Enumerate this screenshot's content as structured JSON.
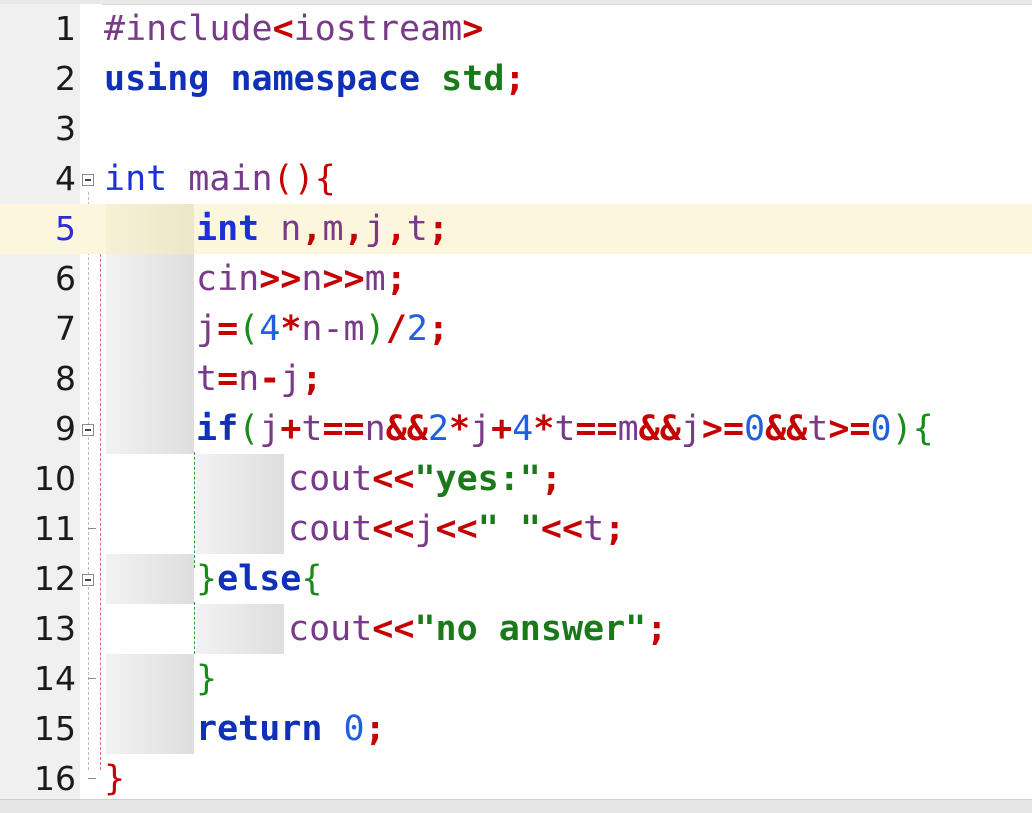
{
  "editor": {
    "language": "C++",
    "current_line": 5,
    "colors": {
      "keyword": "#1030b8",
      "operator": "#c40000",
      "number": "#2060e0",
      "string": "#1a7a1a",
      "identifier": "#7a3a8a",
      "current_line_bg": "#fbf6dc",
      "gutter_bg": "#f0f0f0"
    }
  },
  "lines": [
    {
      "num": "1",
      "text": "#include<iostream>"
    },
    {
      "num": "2",
      "text": "using namespace std;"
    },
    {
      "num": "3",
      "text": ""
    },
    {
      "num": "4",
      "text": "int main(){"
    },
    {
      "num": "5",
      "text": "int n,m,j,t;"
    },
    {
      "num": "6",
      "text": "cin>>n>>m;"
    },
    {
      "num": "7",
      "text": "j=(4*n-m)/2;"
    },
    {
      "num": "8",
      "text": "t=n-j;"
    },
    {
      "num": "9",
      "text": "if(j+t==n&&2*j+4*t==m&&j>=0&&t>=0){"
    },
    {
      "num": "10",
      "text": "cout<<\"yes:\";"
    },
    {
      "num": "11",
      "text": "cout<<j<<\" \"<<t;"
    },
    {
      "num": "12",
      "text": "}else{"
    },
    {
      "num": "13",
      "text": "cout<<\"no answer\";"
    },
    {
      "num": "14",
      "text": "}"
    },
    {
      "num": "15",
      "text": "return 0;"
    },
    {
      "num": "16",
      "text": "}"
    }
  ],
  "tokens": {
    "l1": {
      "hash_include": "#include",
      "lt": "<",
      "lib": "iostream",
      "gt": ">"
    },
    "l2": {
      "using": "using",
      "namespace": "namespace",
      "std": "std",
      "semi": ";"
    },
    "l4": {
      "int": "int",
      "main": "main",
      "lp": "(",
      "rp": ")",
      "lb": "{"
    },
    "l5": {
      "int": "int",
      "n": "n",
      "c1": ",",
      "m": "m",
      "c2": ",",
      "j": "j",
      "c3": ",",
      "t": "t",
      "semi": ";"
    },
    "l6": {
      "cin": "cin",
      "op1": ">>",
      "n": "n",
      "op2": ">>",
      "m": "m",
      "semi": ";"
    },
    "l7": {
      "j": "j",
      "eq": "=",
      "lp": "(",
      "four": "4",
      "mul": "*",
      "n": "n",
      "minus": "-",
      "m": "m",
      "rp": ")",
      "div": "/",
      "two": "2",
      "semi": ";"
    },
    "l8": {
      "t": "t",
      "eq": "=",
      "n": "n",
      "minus": "-",
      "j": "j",
      "semi": ";"
    },
    "l9": {
      "if": "if",
      "lp": "(",
      "j1": "j",
      "plus1": "+",
      "t1": "t",
      "eqeq1": "==",
      "n": "n",
      "and1": "&&",
      "two": "2",
      "mul1": "*",
      "j2": "j",
      "plus2": "+",
      "four": "4",
      "mul2": "*",
      "t2": "t",
      "eqeq2": "==",
      "m": "m",
      "and2": "&&",
      "j3": "j",
      "ge1": ">=",
      "zero1": "0",
      "and3": "&&",
      "t3": "t",
      "ge2": ">=",
      "zero2": "0",
      "rp": ")",
      "lb": "{"
    },
    "l10": {
      "cout": "cout",
      "op": "<<",
      "str": "\"yes:\"",
      "semi": ";"
    },
    "l11": {
      "cout": "cout",
      "op1": "<<",
      "j": "j",
      "op2": "<<",
      "str": "\" \"",
      "op3": "<<",
      "t": "t",
      "semi": ";"
    },
    "l12": {
      "rb": "}",
      "else": "else",
      "lb": "{"
    },
    "l13": {
      "cout": "cout",
      "op": "<<",
      "str": "\"no answer\"",
      "semi": ";"
    },
    "l14": {
      "rb": "}"
    },
    "l15": {
      "return": "return",
      "zero": "0",
      "semi": ";"
    },
    "l16": {
      "rb": "}"
    }
  }
}
